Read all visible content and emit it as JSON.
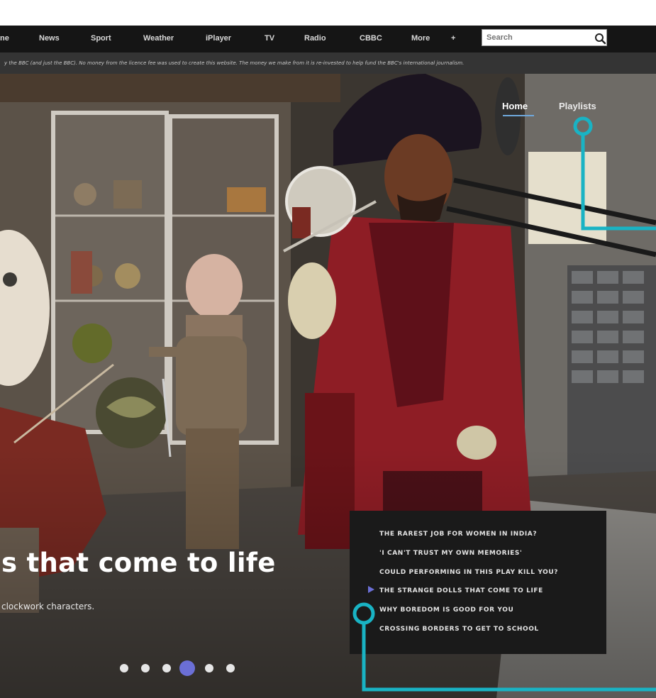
{
  "global_nav": {
    "items": [
      "ne",
      "News",
      "Sport",
      "Weather",
      "iPlayer",
      "TV",
      "Radio",
      "CBBC",
      "More"
    ],
    "more_arrow": "+",
    "search": {
      "placeholder": "Search",
      "icon": "search-icon"
    }
  },
  "disclaimer": "y the BBC (and just the BBC). No money from the licence fee was used to create this website. The money we make from it is re-invested to help fund the BBC's international journalism.",
  "site_nav": {
    "home": "Home",
    "playlists": "Playlists"
  },
  "hero": {
    "headline": "s that come to life",
    "subline": "clockwork characters."
  },
  "playlist": {
    "items": [
      "THE RAREST JOB FOR WOMEN IN INDIA?",
      "'I CAN'T TRUST MY OWN MEMORIES'",
      "COULD PERFORMING IN THIS PLAY KILL YOU?",
      "THE STRANGE DOLLS THAT COME TO LIFE",
      "WHY BOREDOM IS GOOD FOR YOU",
      "CROSSING BORDERS TO GET TO SCHOOL"
    ],
    "current_index": 3
  },
  "carousel": {
    "count": 6,
    "active": 3
  },
  "colors": {
    "accent": "#6b6fd6",
    "callout": "#19b3c4",
    "nav_bg": "#151515",
    "panel_bg": "#1a1a1a"
  }
}
